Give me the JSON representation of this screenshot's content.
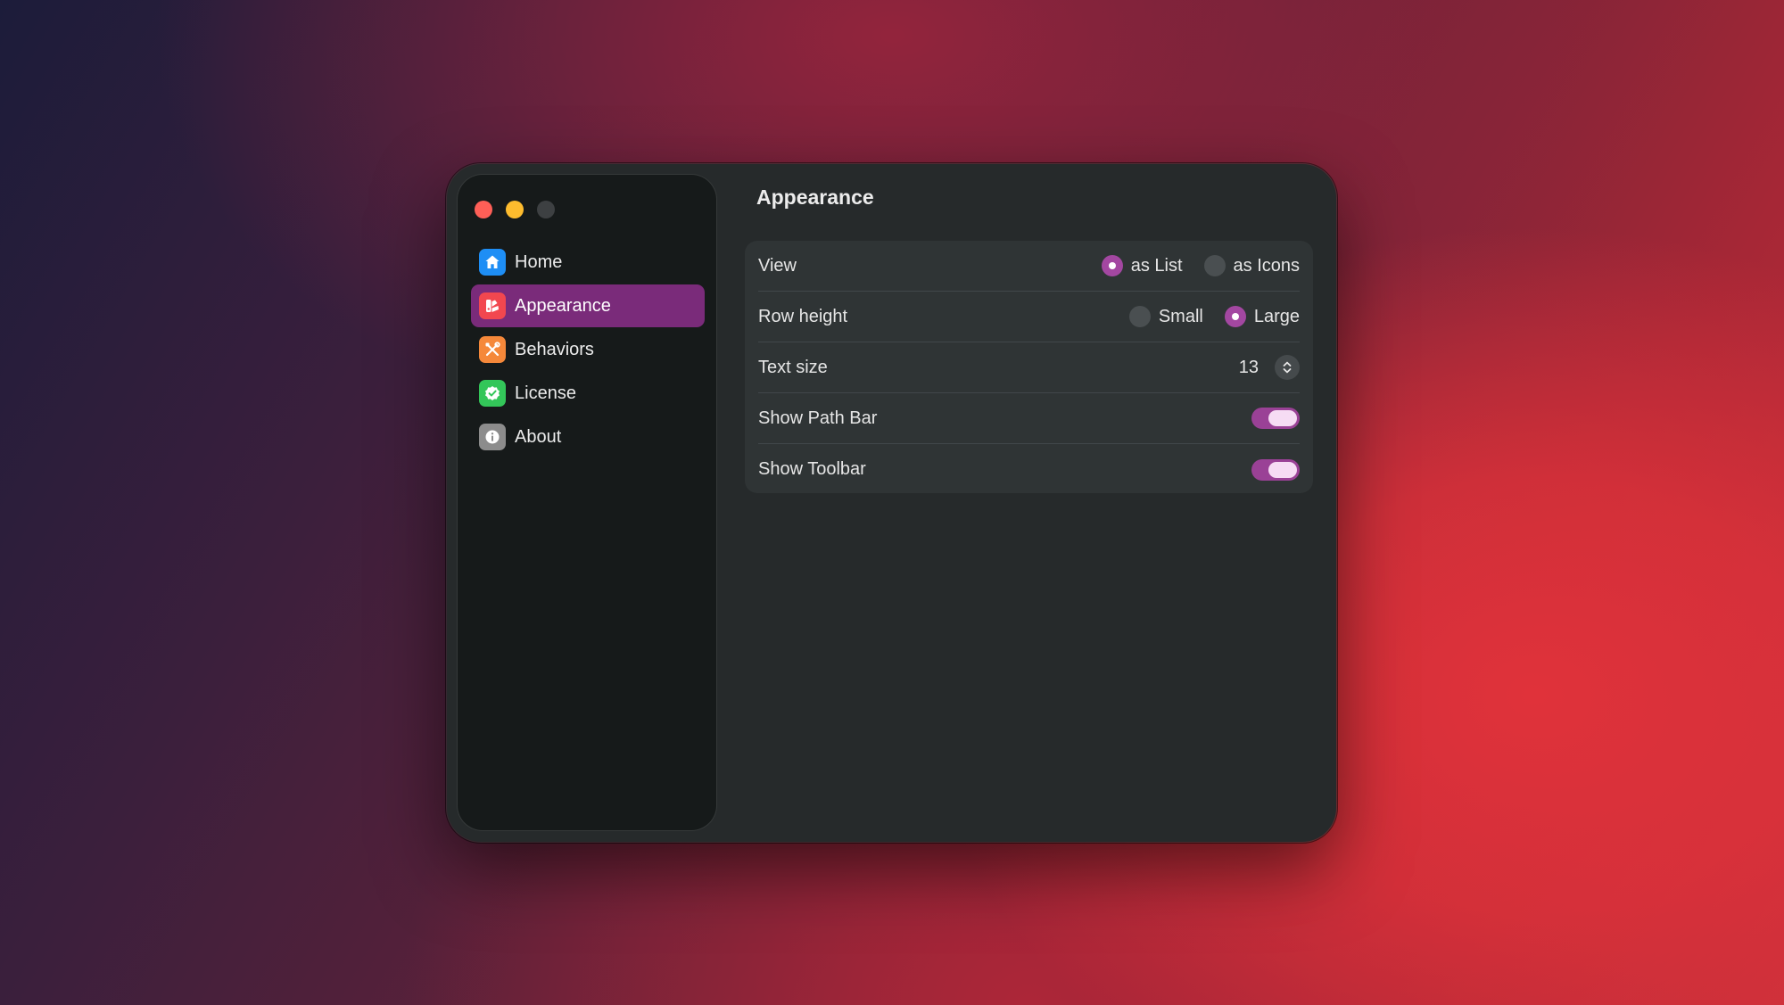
{
  "window": {
    "controls": [
      "close",
      "minimize",
      "zoom"
    ]
  },
  "sidebar": {
    "items": [
      {
        "label": "Home",
        "icon": "house-icon",
        "color": "#1e8ef5",
        "selected": false
      },
      {
        "label": "Appearance",
        "icon": "appearance-icon",
        "color": "#f2474f",
        "selected": true
      },
      {
        "label": "Behaviors",
        "icon": "tools-icon",
        "color": "#f5883a",
        "selected": false
      },
      {
        "label": "License",
        "icon": "badge-check-icon",
        "color": "#33c659",
        "selected": false
      },
      {
        "label": "About",
        "icon": "info-icon",
        "color": "#8c8c8c",
        "selected": false
      }
    ],
    "accent_color": "#7a2b7a"
  },
  "main": {
    "title": "Appearance",
    "settings": {
      "view": {
        "label": "View",
        "options": [
          {
            "label": "as List",
            "selected": true
          },
          {
            "label": "as Icons",
            "selected": false
          }
        ]
      },
      "row_height": {
        "label": "Row height",
        "options": [
          {
            "label": "Small",
            "selected": false
          },
          {
            "label": "Large",
            "selected": true
          }
        ]
      },
      "text_size": {
        "label": "Text size",
        "value": "13"
      },
      "show_path_bar": {
        "label": "Show Path Bar",
        "on": true
      },
      "show_toolbar": {
        "label": "Show Toolbar",
        "on": true
      }
    }
  }
}
